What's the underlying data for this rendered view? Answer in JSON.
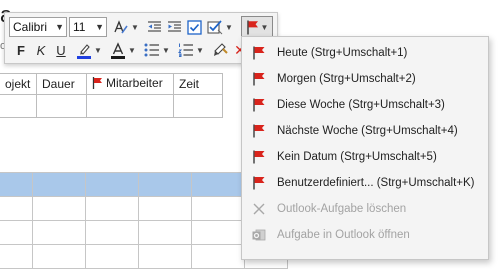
{
  "document": {
    "title_fragment": "a",
    "subtitle_fragment": "or",
    "table_headers": [
      "ojekt",
      "Dauer",
      "Mitarbeiter",
      "Zeit"
    ]
  },
  "mini_toolbar": {
    "font_family": "Calibri",
    "font_size": "11",
    "bold_label": "F",
    "italic_label": "K",
    "underline_label": "U",
    "highlight_color": "#1f3fe0",
    "font_color": "#1a1a1a"
  },
  "followup_menu": {
    "items": [
      {
        "label": "Heute  (Strg+Umschalt+1)",
        "icon": "red-flag-icon",
        "enabled": true
      },
      {
        "label": "Morgen  (Strg+Umschalt+2)",
        "icon": "red-flag-icon",
        "enabled": true
      },
      {
        "label": "Diese Woche  (Strg+Umschalt+3)",
        "icon": "red-flag-icon",
        "enabled": true
      },
      {
        "label": "Nächste Woche  (Strg+Umschalt+4)",
        "icon": "red-flag-icon",
        "enabled": true
      },
      {
        "label": "Kein Datum  (Strg+Umschalt+5)",
        "icon": "red-flag-icon",
        "enabled": true
      },
      {
        "label": "Benutzerdefiniert...  (Strg+Umschalt+K)",
        "icon": "red-flag-icon",
        "enabled": true
      },
      {
        "label": "Outlook-Aufgabe löschen",
        "icon": "close-x-icon",
        "enabled": false
      },
      {
        "label": "Aufgabe in Outlook öffnen",
        "icon": "outlook-icon",
        "enabled": false
      }
    ]
  },
  "colors": {
    "flag_red": "#d9241c",
    "selection_row": "#a9c8ea",
    "checkbox_blue": "#1e64c8"
  }
}
